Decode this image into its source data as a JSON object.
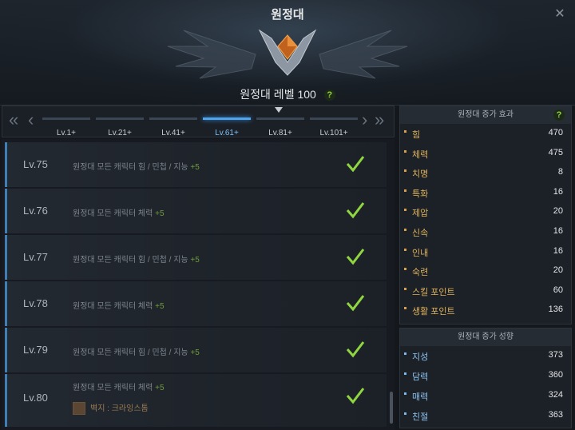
{
  "window": {
    "title": "원정대",
    "close_icon": "close-icon"
  },
  "header": {
    "level_label": "원정대 레벨 100",
    "help": "?"
  },
  "tabs": [
    {
      "label": "Lv.1+"
    },
    {
      "label": "Lv.21+"
    },
    {
      "label": "Lv.41+"
    },
    {
      "label": "Lv.61+",
      "active": true
    },
    {
      "label": "Lv.81+"
    },
    {
      "label": "Lv.101+"
    }
  ],
  "nav": {
    "first": "«",
    "prev": "‹",
    "next": "›",
    "last": "»"
  },
  "rows": [
    {
      "level": "Lv.75",
      "text": "원정대 모든 캐릭터 힘 / 민첩 / 지능",
      "bonus": "+5"
    },
    {
      "level": "Lv.76",
      "text": "원정대 모든 캐릭터 체력",
      "bonus": "+5"
    },
    {
      "level": "Lv.77",
      "text": "원정대 모든 캐릭터 힘 / 민첩 / 지능",
      "bonus": "+5"
    },
    {
      "level": "Lv.78",
      "text": "원정대 모든 캐릭터 체력",
      "bonus": "+5"
    },
    {
      "level": "Lv.79",
      "text": "원정대 모든 캐릭터 힘 / 민첩 / 지능",
      "bonus": "+5"
    },
    {
      "level": "Lv.80",
      "text": "원정대 모든 캐릭터 체력",
      "bonus": "+5",
      "reward": "벽지 : 크라잉스톰"
    }
  ],
  "effects": {
    "title": "원정대 증가 효과",
    "help": "?",
    "stats": [
      {
        "name": "힘",
        "value": "470"
      },
      {
        "name": "체력",
        "value": "475"
      },
      {
        "name": "치명",
        "value": "8"
      },
      {
        "name": "특화",
        "value": "16"
      },
      {
        "name": "제압",
        "value": "20"
      },
      {
        "name": "신속",
        "value": "16"
      },
      {
        "name": "인내",
        "value": "16"
      },
      {
        "name": "숙련",
        "value": "20"
      },
      {
        "name": "스킬 포인트",
        "value": "60"
      },
      {
        "name": "생활 포인트",
        "value": "136"
      }
    ]
  },
  "tendency": {
    "title": "원정대 증가 성향",
    "stats": [
      {
        "name": "지성",
        "value": "373"
      },
      {
        "name": "담력",
        "value": "360"
      },
      {
        "name": "매력",
        "value": "324"
      },
      {
        "name": "친절",
        "value": "363"
      }
    ]
  },
  "colors": {
    "accent": "#4fa4ec",
    "check": "#8fd640",
    "stat_name": "#e0b25a",
    "tendency_name": "#8cc2ee"
  }
}
